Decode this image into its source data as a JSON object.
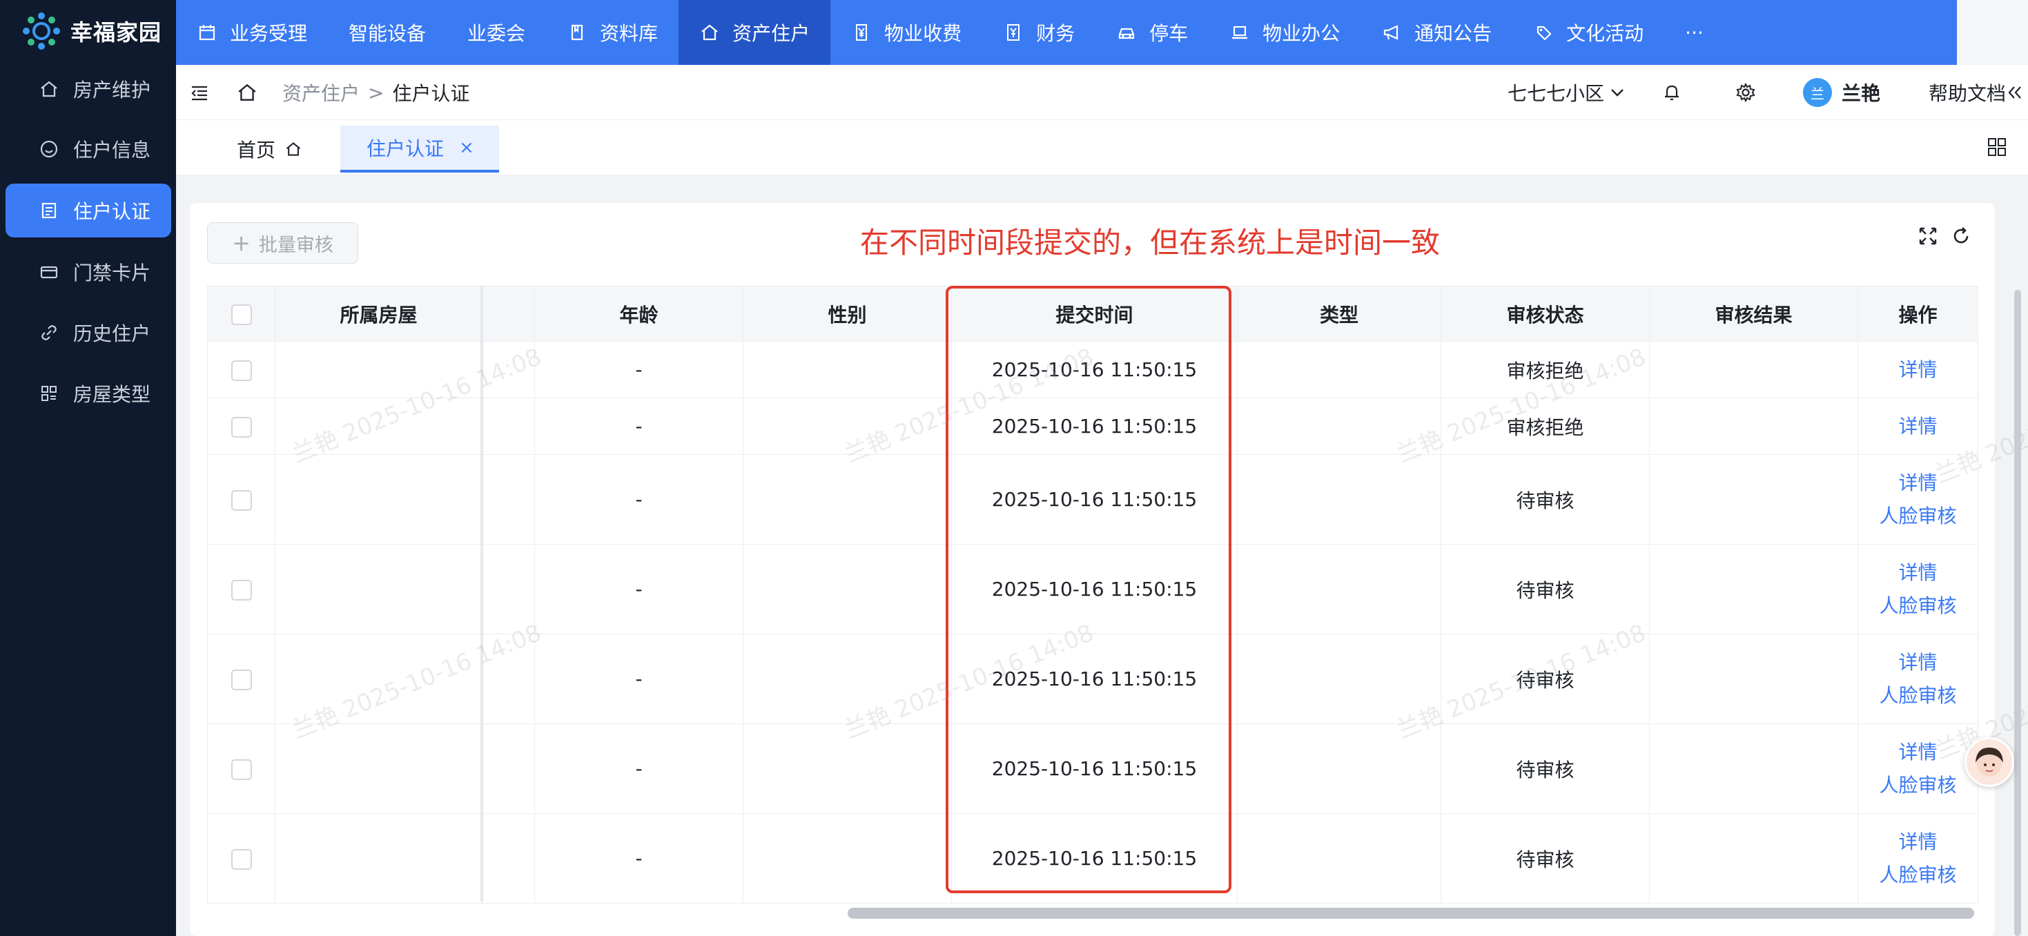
{
  "app": {
    "title": "幸福家园"
  },
  "colors": {
    "primary": "#3a7af3",
    "primary_dark": "#2355c6",
    "sidebar": "#0f1a2e",
    "annotation": "#e23b2e"
  },
  "sidebar": {
    "items": [
      {
        "label": "房产维护",
        "icon": "home-icon"
      },
      {
        "label": "住户信息",
        "icon": "smile-icon"
      },
      {
        "label": "住户认证",
        "icon": "certificate-icon",
        "active": true
      },
      {
        "label": "门禁卡片",
        "icon": "card-icon"
      },
      {
        "label": "历史住户",
        "icon": "link-icon"
      },
      {
        "label": "房屋类型",
        "icon": "grid-icon"
      }
    ]
  },
  "topnav": {
    "items": [
      {
        "label": "业务受理",
        "icon": "calendar-icon"
      },
      {
        "label": "智能设备",
        "icon": ""
      },
      {
        "label": "业委会",
        "icon": ""
      },
      {
        "label": "资料库",
        "icon": "book-icon"
      },
      {
        "label": "资产住户",
        "icon": "home-icon",
        "active": true
      },
      {
        "label": "物业收费",
        "icon": "yen-icon"
      },
      {
        "label": "财务",
        "icon": "finance-icon"
      },
      {
        "label": "停车",
        "icon": "car-icon"
      },
      {
        "label": "物业办公",
        "icon": "laptop-icon"
      },
      {
        "label": "通知公告",
        "icon": "megaphone-icon"
      },
      {
        "label": "文化活动",
        "icon": "tag-icon"
      },
      {
        "label": "···",
        "icon": ""
      }
    ]
  },
  "breadcrumb": {
    "parent": "资产住户",
    "separator": ">",
    "current": "住户认证"
  },
  "header": {
    "community": "七七七小区",
    "user_name": "兰艳",
    "user_initial": "兰",
    "help": "帮助文档"
  },
  "tabs": [
    {
      "label": "首页"
    },
    {
      "label": "住户认证",
      "close": "×",
      "active": true
    }
  ],
  "toolbar": {
    "batch_label": "批量审核",
    "batch_prefix": "+"
  },
  "annotation": "在不同时间段提交的，但在系统上是时间一致",
  "table": {
    "headers": {
      "house": "所属房屋",
      "age": "年龄",
      "gender": "性别",
      "submit_time": "提交时间",
      "type": "类型",
      "status": "审核状态",
      "result": "审核结果",
      "ops": "操作"
    },
    "rows": [
      {
        "age": "-",
        "time": "2025-10-16 11:50:15",
        "status": "审核拒绝",
        "ops": [
          "详情"
        ]
      },
      {
        "age": "-",
        "time": "2025-10-16 11:50:15",
        "status": "审核拒绝",
        "ops": [
          "详情"
        ]
      },
      {
        "age": "-",
        "time": "2025-10-16 11:50:15",
        "status": "待审核",
        "ops": [
          "详情",
          "人脸审核"
        ]
      },
      {
        "age": "-",
        "time": "2025-10-16 11:50:15",
        "status": "待审核",
        "ops": [
          "详情",
          "人脸审核"
        ]
      },
      {
        "age": "-",
        "time": "2025-10-16 11:50:15",
        "status": "待审核",
        "ops": [
          "详情",
          "人脸审核"
        ]
      },
      {
        "age": "-",
        "time": "2025-10-16 11:50:15",
        "status": "待审核",
        "ops": [
          "详情",
          "人脸审核"
        ]
      },
      {
        "age": "-",
        "time": "2025-10-16 11:50:15",
        "status": "待审核",
        "ops": [
          "详情",
          "人脸审核"
        ]
      }
    ]
  },
  "watermark": "兰艳 2025-10-16 14:08"
}
